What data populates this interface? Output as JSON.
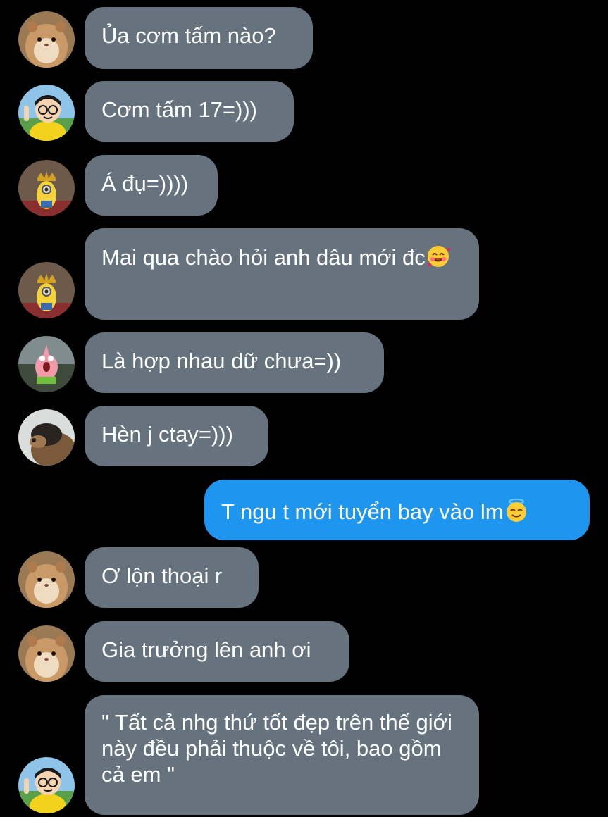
{
  "messages": [
    {
      "sender": "hamster",
      "text": "Ủa cơm tấm nào?"
    },
    {
      "sender": "nobita",
      "text": "Cơm tấm 17=)))"
    },
    {
      "sender": "minion-king",
      "text": "Á đụ=))))"
    },
    {
      "sender": "minion-king",
      "text": "Mai qua chào hỏi anh dâu mới đc",
      "emoji": "smiling-face-with-hearts-icon"
    },
    {
      "sender": "patrick",
      "text": "Là hợp nhau dữ chưa=))"
    },
    {
      "sender": "bear",
      "text": "Hèn j ctay=)))"
    },
    {
      "sender": "me",
      "text": "T ngu t mới tuyển bay vào lm",
      "emoji": "smiling-face-with-halo-icon"
    },
    {
      "sender": "hamster",
      "text": "Ơ lộn thoại r"
    },
    {
      "sender": "hamster",
      "text": "Gia trưởng lên anh ơi"
    },
    {
      "sender": "nobita",
      "text": "\" Tất cả nhg thứ tốt đẹp trên thế giới này đều phải thuộc về tôi, bao gồm cả em \""
    }
  ],
  "colors": {
    "background": "#000000",
    "incoming_bubble": "#66737f",
    "outgoing_bubble": "#1e96f0",
    "text": "#ffffff"
  }
}
